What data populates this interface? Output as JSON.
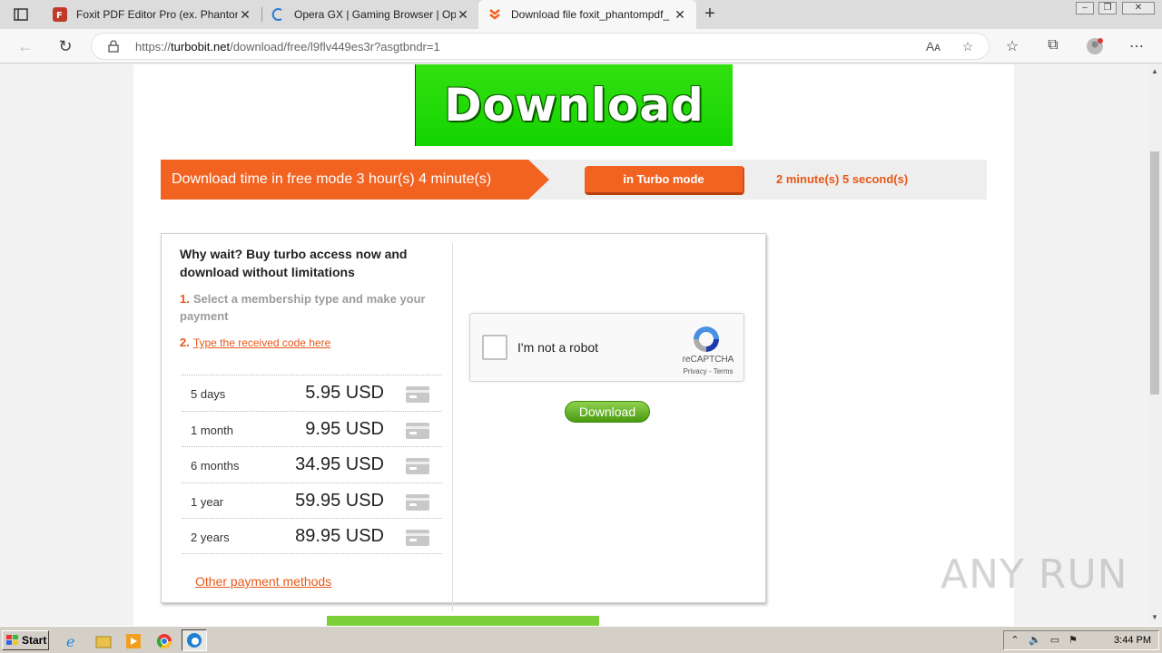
{
  "browser": {
    "tabs": [
      {
        "title": "Foxit PDF Editor Pro (ex. Phantom",
        "active": false
      },
      {
        "title": "Opera GX | Gaming Browser | Op",
        "active": false
      },
      {
        "title": "Download file foxit_phantompdf_",
        "active": true
      }
    ],
    "new_tab": "+",
    "url_prefix": "https://",
    "url_domain": "turbobit.net",
    "url_path": "/download/free/l9flv449es3r?asgtbndr=1"
  },
  "page": {
    "banner_text": "Download",
    "free_mode_text": "Download time in free mode 3 hour(s) 4 minute(s)",
    "turbo_button": "in Turbo mode",
    "turbo_time": "2 minute(s) 5 second(s)",
    "why_wait": "Why wait? Buy turbo access now and download without limitations",
    "step1_num": "1.",
    "step1_text": "Select a membership type and make your payment",
    "step2_num": "2.",
    "step2_link": "Type the received code here",
    "prices": [
      {
        "duration": "5 days",
        "amount": "5.95 USD"
      },
      {
        "duration": "1 month",
        "amount": "9.95 USD"
      },
      {
        "duration": "6 months",
        "amount": "34.95 USD"
      },
      {
        "duration": "1 year",
        "amount": "59.95 USD"
      },
      {
        "duration": "2 years",
        "amount": "89.95 USD"
      }
    ],
    "other_methods": "Other payment methods",
    "captcha": {
      "label": "I'm not a robot",
      "brand": "reCAPTCHA",
      "terms": "Privacy - Terms"
    },
    "download_button": "Download"
  },
  "watermark": "ANY RUN",
  "taskbar": {
    "start": "Start",
    "clock": "3:44 PM"
  },
  "colors": {
    "accent_orange": "#f26322",
    "banner_green": "#14d400",
    "link_orange": "#e8581b"
  }
}
